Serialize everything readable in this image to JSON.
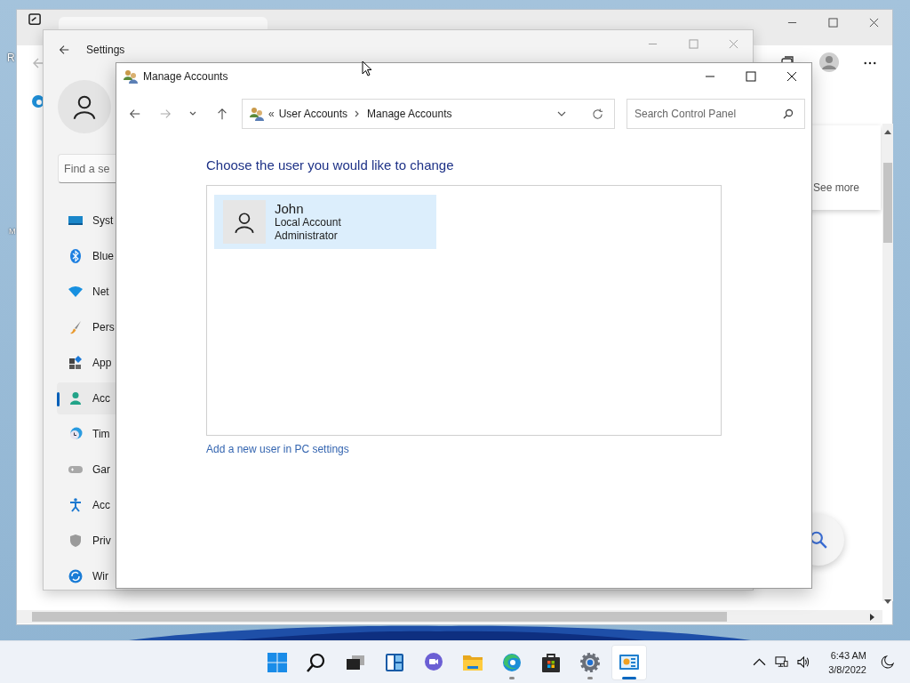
{
  "desktop": {
    "labels": [
      "R",
      "M"
    ]
  },
  "browser": {
    "see_more": "See more"
  },
  "settings": {
    "title": "Settings",
    "search": {
      "placeholder": "Find a se"
    },
    "nav": [
      {
        "label": "Syst",
        "kind": "system",
        "selected": false
      },
      {
        "label": "Blue",
        "kind": "bluetooth",
        "selected": false
      },
      {
        "label": "Net",
        "kind": "network",
        "selected": false
      },
      {
        "label": "Pers",
        "kind": "personalization",
        "selected": false
      },
      {
        "label": "App",
        "kind": "apps",
        "selected": false
      },
      {
        "label": "Acc",
        "kind": "accounts",
        "selected": true
      },
      {
        "label": "Tim",
        "kind": "time",
        "selected": false
      },
      {
        "label": "Gar",
        "kind": "gaming",
        "selected": false
      },
      {
        "label": "Acc",
        "kind": "accessibility",
        "selected": false
      },
      {
        "label": "Priv",
        "kind": "privacy",
        "selected": false
      },
      {
        "label": "Wir",
        "kind": "update",
        "selected": false
      }
    ]
  },
  "dialog": {
    "title": "Manage Accounts",
    "breadcrumb_prefix": "«",
    "breadcrumb": [
      "User Accounts",
      "Manage Accounts"
    ],
    "search": {
      "placeholder": "Search Control Panel"
    },
    "heading": "Choose the user you would like to change",
    "accounts": [
      {
        "name": "John",
        "type": "Local Account",
        "role": "Administrator",
        "selected": true
      }
    ],
    "link": "Add a new user in PC settings"
  },
  "taskbar": {
    "apps": [
      {
        "kind": "start",
        "running": false,
        "active": false
      },
      {
        "kind": "search",
        "running": false,
        "active": false
      },
      {
        "kind": "taskview",
        "running": false,
        "active": false
      },
      {
        "kind": "widgets",
        "running": false,
        "active": false
      },
      {
        "kind": "chat",
        "running": false,
        "active": false
      },
      {
        "kind": "explorer",
        "running": false,
        "active": false
      },
      {
        "kind": "edge",
        "running": true,
        "active": false
      },
      {
        "kind": "store",
        "running": false,
        "active": false
      },
      {
        "kind": "settings",
        "running": true,
        "active": false
      },
      {
        "kind": "controlpanel",
        "running": true,
        "active": true
      }
    ],
    "time": "6:43 AM",
    "date": "3/8/2022"
  }
}
